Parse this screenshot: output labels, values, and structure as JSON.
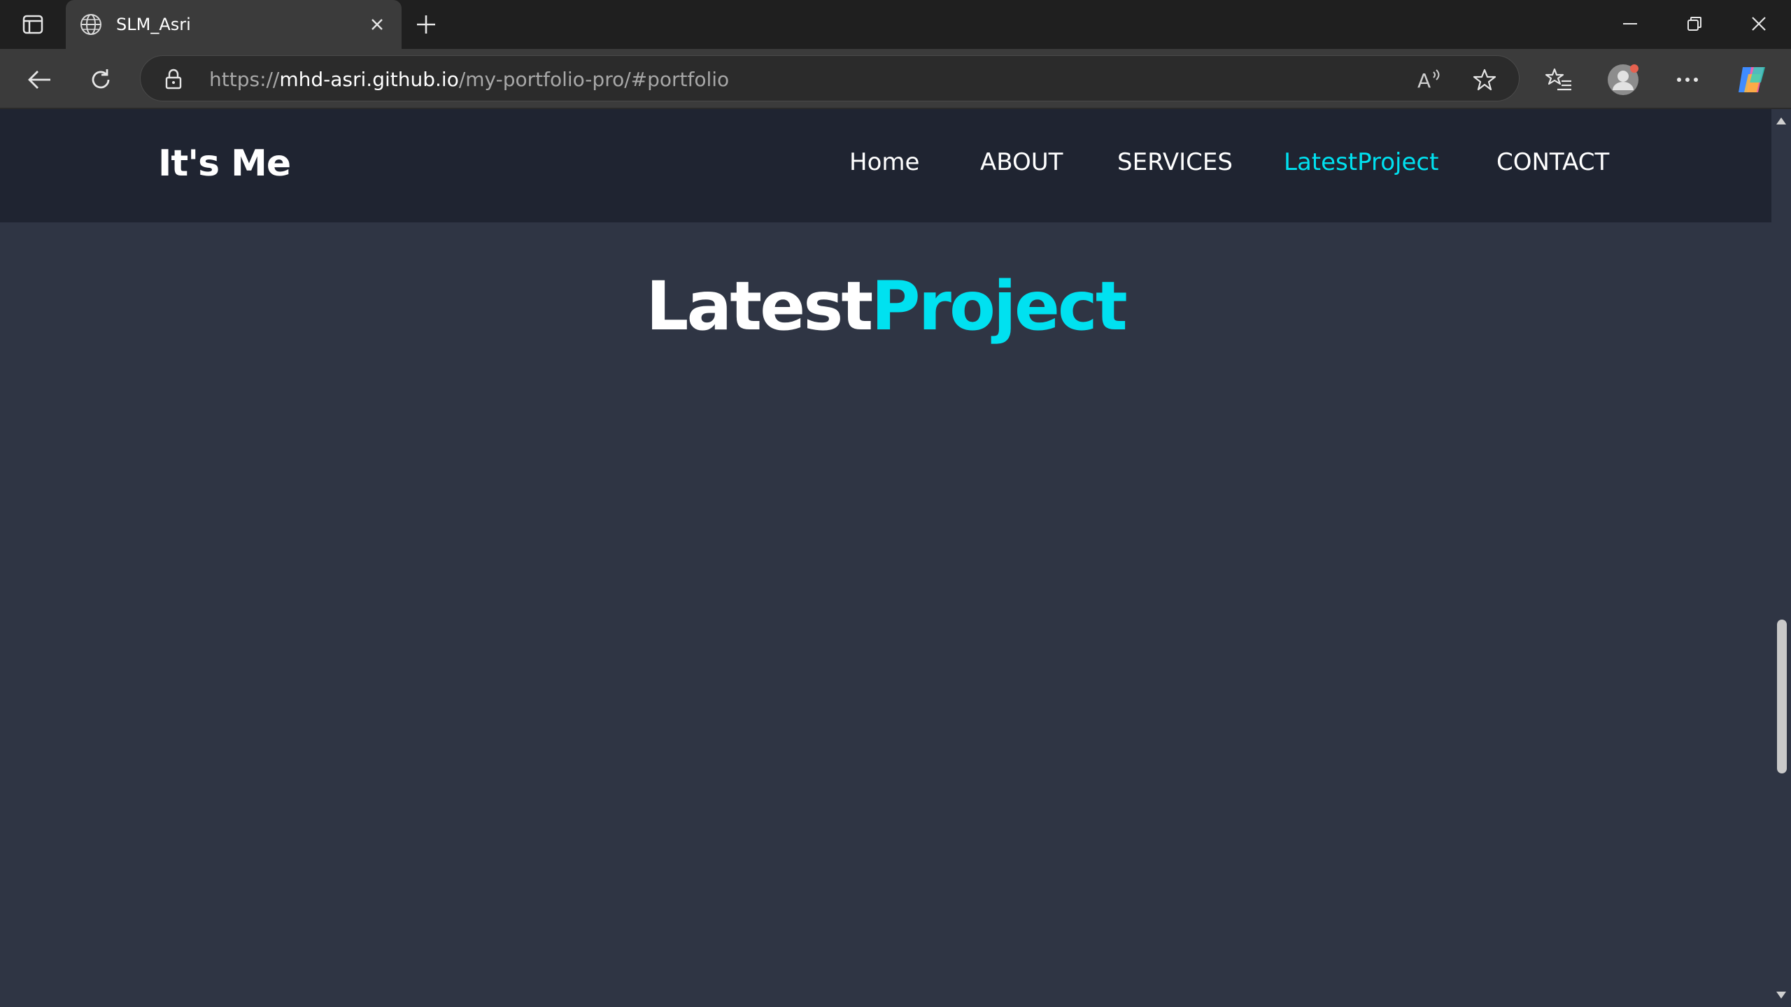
{
  "browser": {
    "tab_title": "SLM_Asri",
    "url_scheme": "https://",
    "url_host": "mhd-asri.github.io",
    "url_path": "/my-portfolio-pro/#portfolio",
    "icons": {
      "sidebar": "tab-actions-icon",
      "tab": "globe-icon",
      "close": "close-icon",
      "new_tab": "plus-icon",
      "back": "back-arrow-icon",
      "reload": "reload-icon",
      "lock": "lock-icon",
      "read_aloud": "read-aloud-icon",
      "favorite": "star-icon",
      "favorites": "favorites-list-icon",
      "profile": "profile-icon",
      "more": "more-icon",
      "copilot": "copilot-icon",
      "minimize": "minimize-icon",
      "restore": "restore-icon",
      "window_close": "window-close-icon"
    }
  },
  "site": {
    "logo": "It's Me",
    "nav": [
      {
        "label": "Home",
        "active": false
      },
      {
        "label": "ABOUT",
        "active": false
      },
      {
        "label": "SERVICES",
        "active": false
      },
      {
        "label": "LatestProject",
        "active": true
      },
      {
        "label": "CONTACT",
        "active": false
      }
    ],
    "section": {
      "title_part1": "Latest",
      "title_part2": "Project"
    }
  },
  "colors": {
    "accent": "#00e1f0",
    "header_bg": "#1f2431",
    "page_bg": "#2f3544",
    "text": "#ffffff"
  }
}
